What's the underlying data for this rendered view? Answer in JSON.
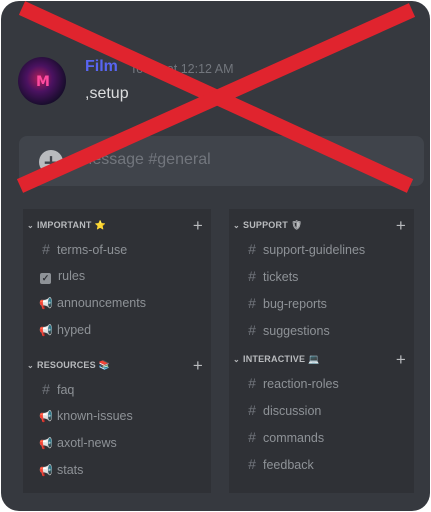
{
  "message": {
    "author": "Film",
    "timestamp": "Today at 12:12 AM",
    "text": ",setup",
    "avatar_glyph": "M"
  },
  "chat_input": {
    "placeholder": "Message #general",
    "add_glyph": "+"
  },
  "left_panel": {
    "categories": [
      {
        "name": "IMPORTANT",
        "emoji": "⭐",
        "channels": [
          {
            "name": "terms-of-use",
            "icon": "hash-icon"
          },
          {
            "name": "rules",
            "icon": "rules-icon"
          },
          {
            "name": "announcements",
            "icon": "megaphone-icon"
          },
          {
            "name": "hyped",
            "icon": "megaphone-icon"
          }
        ]
      },
      {
        "name": "RESOURCES",
        "emoji": "📚",
        "channels": [
          {
            "name": "faq",
            "icon": "hash-icon"
          },
          {
            "name": "known-issues",
            "icon": "megaphone-icon"
          },
          {
            "name": "axotl-news",
            "icon": "megaphone-icon"
          },
          {
            "name": "stats",
            "icon": "megaphone-icon"
          }
        ]
      }
    ]
  },
  "right_panel": {
    "categories": [
      {
        "name": "SUPPORT",
        "emoji": "🛡",
        "channels": [
          {
            "name": "support-guidelines",
            "icon": "hash-icon"
          },
          {
            "name": "tickets",
            "icon": "hash-icon"
          },
          {
            "name": "bug-reports",
            "icon": "hash-icon"
          },
          {
            "name": "suggestions",
            "icon": "hash-icon"
          }
        ]
      },
      {
        "name": "INTERACTIVE",
        "emoji": "💻",
        "channels": [
          {
            "name": "reaction-roles",
            "icon": "hash-icon"
          },
          {
            "name": "discussion",
            "icon": "hash-icon"
          },
          {
            "name": "commands",
            "icon": "hash-icon"
          },
          {
            "name": "feedback",
            "icon": "hash-icon"
          }
        ]
      }
    ]
  },
  "colors": {
    "background": "#36393f",
    "panel": "#2f3136",
    "author": "#5865f2",
    "overlay_x": "#e0242e"
  },
  "glyphs": {
    "chevron": "⌄",
    "plus": "+",
    "hash": "#",
    "megaphone": "📢",
    "check": "✓"
  }
}
